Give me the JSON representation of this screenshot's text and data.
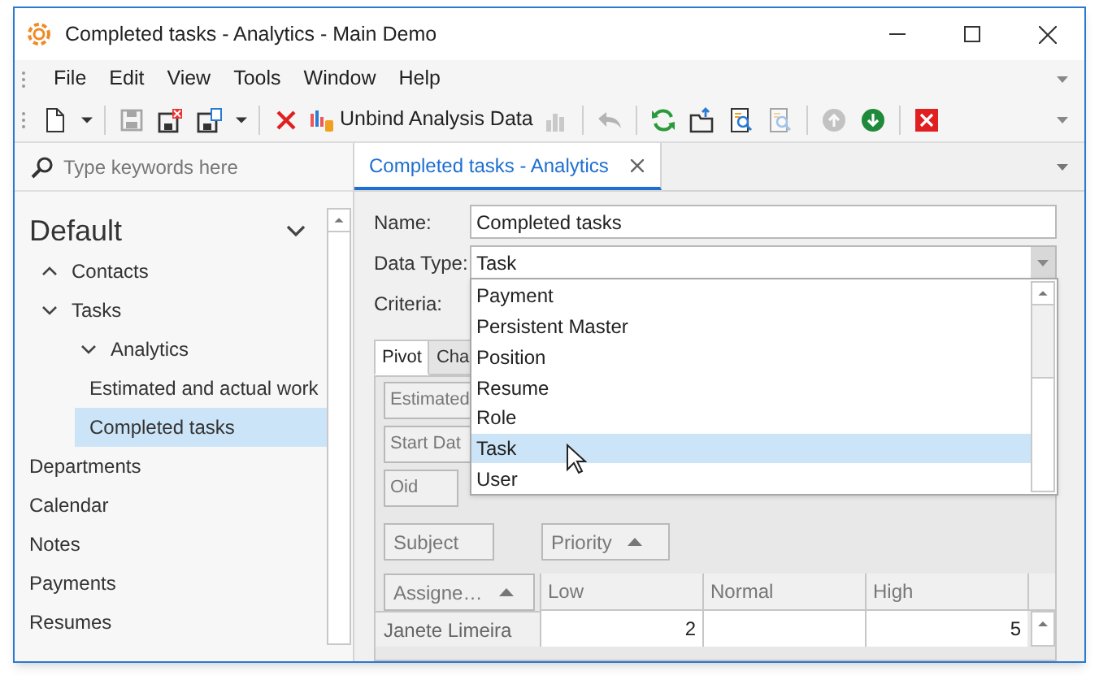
{
  "window": {
    "title": "Completed tasks - Analytics - Main Demo"
  },
  "menu": [
    {
      "label": "File"
    },
    {
      "label": "Edit"
    },
    {
      "label": "View"
    },
    {
      "label": "Tools"
    },
    {
      "label": "Window"
    },
    {
      "label": "Help"
    }
  ],
  "toolbar": [
    {
      "kind": "new",
      "disabled": false
    },
    {
      "kind": "caret",
      "disabled": false
    },
    {
      "kind": "separator"
    },
    {
      "kind": "save",
      "disabled": true
    },
    {
      "kind": "save-close",
      "disabled": false
    },
    {
      "kind": "save-as",
      "disabled": false
    },
    {
      "kind": "caret",
      "disabled": false
    },
    {
      "kind": "separator"
    },
    {
      "kind": "delete",
      "disabled": false
    },
    {
      "kind": "unbind",
      "label": "Unbind Analysis Data",
      "disabled": false
    },
    {
      "kind": "chart",
      "disabled": true
    },
    {
      "kind": "separator"
    },
    {
      "kind": "undo",
      "disabled": true
    },
    {
      "kind": "separator"
    },
    {
      "kind": "refresh",
      "disabled": false
    },
    {
      "kind": "export",
      "disabled": false
    },
    {
      "kind": "report",
      "disabled": false
    },
    {
      "kind": "report",
      "disabled": true
    },
    {
      "kind": "separator"
    },
    {
      "kind": "up",
      "disabled": true
    },
    {
      "kind": "down",
      "disabled": false
    },
    {
      "kind": "separator"
    },
    {
      "kind": "close",
      "disabled": false
    }
  ],
  "search": {
    "placeholder": "Type keywords here"
  },
  "navigation": {
    "group": "Default",
    "expanded": true,
    "items": [
      {
        "label": "Contacts",
        "expanded": false,
        "selected": false
      },
      {
        "label": "Tasks",
        "expanded": true,
        "selected": false,
        "children": [
          {
            "label": "Analytics",
            "expanded": true,
            "selected": false,
            "children": [
              {
                "label": "Estimated and actual work",
                "selected": false
              },
              {
                "label": "Completed tasks",
                "selected": true
              }
            ]
          }
        ]
      },
      {
        "label": "Departments",
        "selected": false
      },
      {
        "label": "Calendar",
        "selected": false
      },
      {
        "label": "Notes",
        "selected": false
      },
      {
        "label": "Payments",
        "selected": false
      },
      {
        "label": "Resumes",
        "selected": false
      }
    ]
  },
  "document_tabs": [
    {
      "label": "Completed tasks - Analytics",
      "selected": true
    }
  ],
  "form": {
    "fields": [
      {
        "label": "Name:",
        "kind": "text",
        "value": "Completed tasks"
      },
      {
        "label": "Data Type:",
        "kind": "combo",
        "value": "Task"
      },
      {
        "label": "Criteria:",
        "kind": "hidden"
      }
    ]
  },
  "dropdown": {
    "options": [
      {
        "label": "Payment",
        "selected": false
      },
      {
        "label": "Persistent Master",
        "selected": false
      },
      {
        "label": "Position",
        "selected": false
      },
      {
        "label": "Resume",
        "selected": false
      },
      {
        "label": "Role",
        "selected": false
      },
      {
        "label": "Task",
        "selected": true
      },
      {
        "label": "User",
        "selected": false
      }
    ]
  },
  "pivot": {
    "tabs": [
      {
        "label": "Pivot",
        "selected": true
      },
      {
        "label": "Cha",
        "selected": false
      }
    ],
    "filter_fields": [
      "Estimated",
      "Start Dat",
      "Oid"
    ],
    "column_fields": [
      {
        "label": "Subject",
        "sorted": false
      },
      {
        "label": "Priority",
        "sorted": true
      }
    ],
    "row_field": {
      "label": "Assigne…",
      "sorted": true
    },
    "columns": [
      "Low",
      "Normal",
      "High"
    ],
    "rows": [
      {
        "label": "Janete Limeira",
        "cells": [
          "2",
          "",
          "5"
        ]
      }
    ]
  }
}
